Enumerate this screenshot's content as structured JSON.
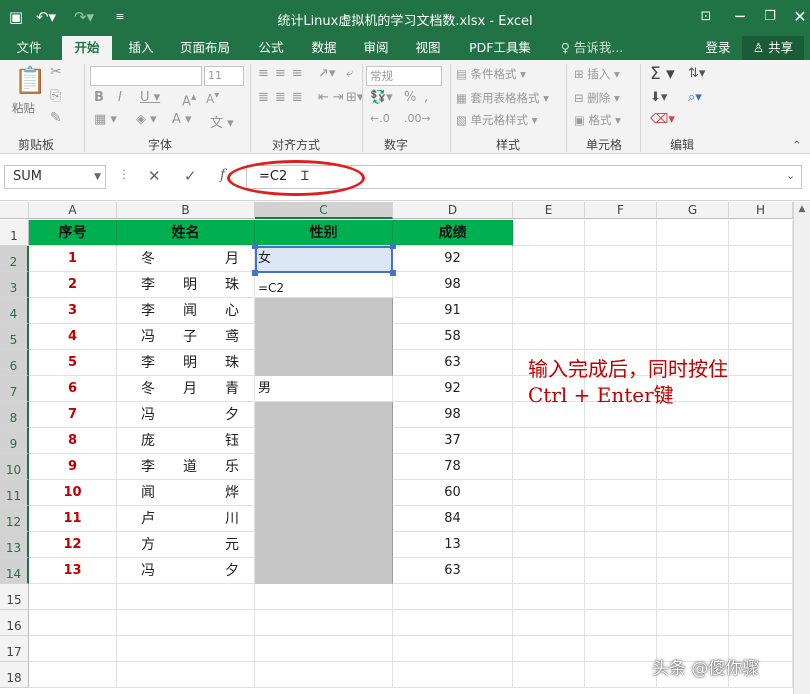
{
  "app": {
    "title": "统计Linux虚拟机的学习文档数.xlsx - Excel"
  },
  "quick_access": {
    "save_icon": "save-icon",
    "undo_icon": "undo-icon",
    "redo_icon": "redo-icon",
    "customize_icon": "customize-icon"
  },
  "tabs": [
    {
      "label": "文件"
    },
    {
      "label": "开始"
    },
    {
      "label": "插入"
    },
    {
      "label": "页面布局"
    },
    {
      "label": "公式"
    },
    {
      "label": "数据"
    },
    {
      "label": "审阅"
    },
    {
      "label": "视图"
    },
    {
      "label": "PDF工具集"
    },
    {
      "label": "♀ 告诉我..."
    }
  ],
  "account": {
    "login": "登录",
    "share": "共享"
  },
  "ribbon": {
    "clipboard": {
      "group": "剪贴板",
      "paste": "粘贴"
    },
    "font": {
      "group": "字体",
      "size": "11"
    },
    "align": {
      "group": "对齐方式"
    },
    "number": {
      "group": "数字",
      "format": "常规"
    },
    "styles": {
      "group": "样式",
      "cond": "条件格式",
      "table": "套用表格格式",
      "cell": "单元格样式"
    },
    "cells": {
      "group": "单元格",
      "insert": "插入",
      "delete": "删除",
      "format": "格式"
    },
    "editing": {
      "group": "编辑"
    }
  },
  "formula_bar": {
    "name_box": "SUM",
    "formula": "=C2"
  },
  "columns": [
    "A",
    "B",
    "C",
    "D",
    "E",
    "F",
    "G",
    "H"
  ],
  "rows": [
    "1",
    "2",
    "3",
    "4",
    "5",
    "6",
    "7",
    "8",
    "9",
    "10",
    "11",
    "12",
    "13",
    "14",
    "15",
    "16",
    "17",
    "18"
  ],
  "sheet": {
    "headers": [
      "序号",
      "姓名",
      "性别",
      "成绩"
    ],
    "data": [
      {
        "no": "1",
        "name": [
          "冬",
          "",
          "月"
        ],
        "gender": "女",
        "grade": "92"
      },
      {
        "no": "2",
        "name": [
          "李",
          "明",
          "珠"
        ],
        "gender": "=C2",
        "grade": "98"
      },
      {
        "no": "3",
        "name": [
          "李",
          "闻",
          "心"
        ],
        "gender": "",
        "grade": "91"
      },
      {
        "no": "4",
        "name": [
          "冯",
          "子",
          "鸢"
        ],
        "gender": "",
        "grade": "58"
      },
      {
        "no": "5",
        "name": [
          "李",
          "明",
          "珠"
        ],
        "gender": "",
        "grade": "63"
      },
      {
        "no": "6",
        "name": [
          "冬",
          "月",
          "青"
        ],
        "gender": "男",
        "grade": "92"
      },
      {
        "no": "7",
        "name": [
          "冯",
          "",
          "夕"
        ],
        "gender": "",
        "grade": "98"
      },
      {
        "no": "8",
        "name": [
          "庞",
          "",
          "钰"
        ],
        "gender": "",
        "grade": "37"
      },
      {
        "no": "9",
        "name": [
          "李",
          "道",
          "乐"
        ],
        "gender": "",
        "grade": "78"
      },
      {
        "no": "10",
        "name": [
          "闻",
          "",
          "烨"
        ],
        "gender": "",
        "grade": "60"
      },
      {
        "no": "11",
        "name": [
          "卢",
          "",
          "川"
        ],
        "gender": "",
        "grade": "84"
      },
      {
        "no": "12",
        "name": [
          "方",
          "",
          "元"
        ],
        "gender": "",
        "grade": "13"
      },
      {
        "no": "13",
        "name": [
          "冯",
          "",
          "夕"
        ],
        "gender": "",
        "grade": "63"
      }
    ]
  },
  "annotation": {
    "line1": "输入完成后，同时按住",
    "line2": "Ctrl + Enter键"
  },
  "watermark": "头条 @傻你骤"
}
